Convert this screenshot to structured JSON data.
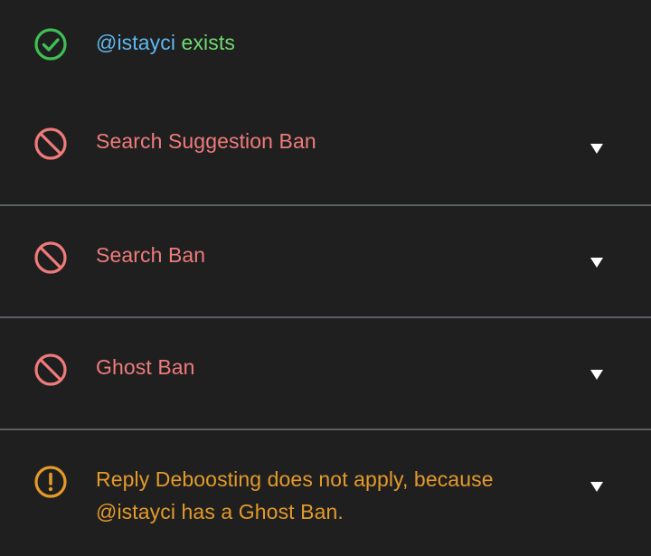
{
  "colors": {
    "background": "#1f1f1f",
    "divider": "#5a5f63",
    "success": "#3fbe55",
    "handle": "#5eb8ef",
    "exists_text": "#6fdc6f",
    "ban": "#ef7b7b",
    "warning": "#e39a2a",
    "chevron": "#ffffff"
  },
  "status": {
    "icon": "check-circle-icon",
    "handle": "@istayci",
    "suffix": " exists"
  },
  "checks": [
    {
      "label": "Search Suggestion Ban",
      "icon": "ban-icon",
      "chevron": "chevron-down-icon"
    },
    {
      "label": "Search Ban",
      "icon": "ban-icon",
      "chevron": "chevron-down-icon"
    },
    {
      "label": "Ghost Ban",
      "icon": "ban-icon",
      "chevron": "chevron-down-icon"
    },
    {
      "label": "Reply Deboosting does not apply, because @istayci has a Ghost Ban.",
      "icon": "warning-circle-icon",
      "chevron": "chevron-down-icon"
    }
  ]
}
